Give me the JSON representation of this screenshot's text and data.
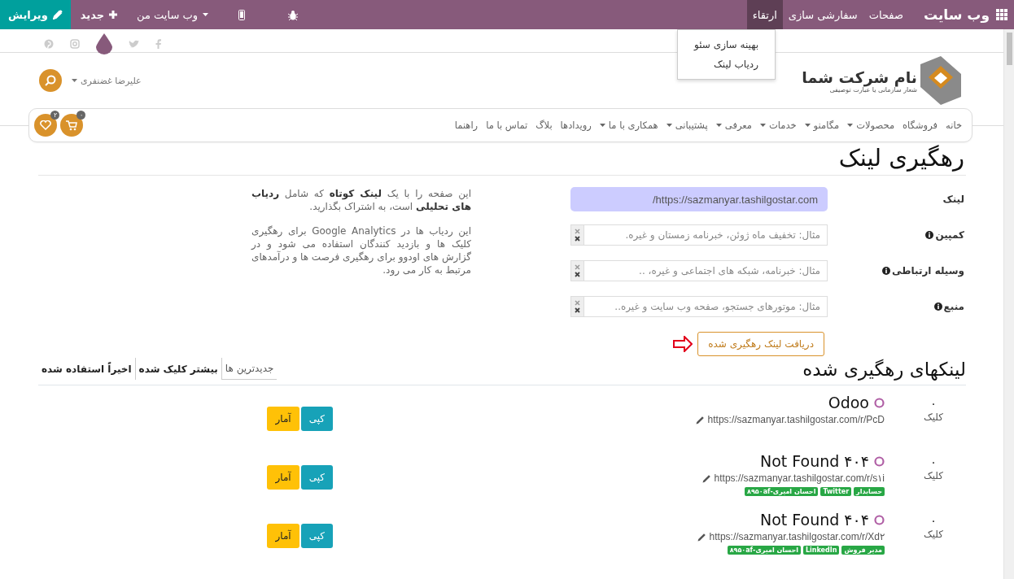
{
  "top_bar": {
    "app_title": "وب سایت",
    "menus": [
      {
        "label": "صفحات",
        "selected": false
      },
      {
        "label": "سفارشی سازی",
        "selected": false
      },
      {
        "label": "ارتقاء",
        "selected": true
      }
    ],
    "actions": [
      {
        "kind": "debug"
      },
      {
        "kind": "mobile"
      },
      {
        "kind": "dropdown",
        "label": "وب سایت من"
      },
      {
        "kind": "new",
        "label": "جدید"
      },
      {
        "kind": "edit",
        "label": "ویرایش"
      }
    ]
  },
  "dropdown_menu": [
    "بهینه سازی سئو",
    "ردیاب لینک"
  ],
  "header": {
    "company_name": "نام شرکت شما",
    "tagline": "شعار سازمانی یا عبارت توصیفی",
    "user_name": "علیرضا غضنفری"
  },
  "nav": {
    "items": [
      {
        "label": "خانه",
        "dropdown": false
      },
      {
        "label": "فروشگاه",
        "dropdown": false
      },
      {
        "label": "محصولات",
        "dropdown": true
      },
      {
        "label": "مگامنو",
        "dropdown": true
      },
      {
        "label": "خدمات",
        "dropdown": true
      },
      {
        "label": "معرفی",
        "dropdown": true
      },
      {
        "label": "پشتیبانی",
        "dropdown": true
      },
      {
        "label": "همکاری با ما",
        "dropdown": true
      },
      {
        "label": "رویدادها",
        "dropdown": false
      },
      {
        "label": "بلاگ",
        "dropdown": false
      },
      {
        "label": "تماس با ما",
        "dropdown": false
      },
      {
        "label": "راهنما",
        "dropdown": false
      }
    ],
    "cart_count": "۰",
    "wishlist_count": "۲"
  },
  "page_title": "رهگیری لینک",
  "form": {
    "fields": [
      {
        "kind": "url",
        "label": "لینک",
        "info": false,
        "value": "https://sazmanyar.tashilgostar.com/"
      },
      {
        "kind": "select",
        "label": "کمپین",
        "info": true,
        "placeholder": "مثال: تخفیف ماه ژوئن، خبرنامه زمستان و غیره."
      },
      {
        "kind": "select",
        "label": "وسیله ارتباطی",
        "info": true,
        "placeholder": "مثال: خبرنامه، شبکه های اجتماعی و غیره، .."
      },
      {
        "kind": "select",
        "label": "منبع",
        "info": true,
        "placeholder": "مثال: موتورهای جستجو، صفحه وب سایت و غیره.."
      }
    ],
    "submit": "دریافت لینک رهگیری شده"
  },
  "help": [
    "این صفحه را با یک **لینک کوتاه** که شامل **ردیاب های تحلیلی** است، به اشتراک بگذارید.",
    "این ردیاب ها در Google Analytics برای رهگیری کلیک ها و بازدید کنندگان استفاده می شود و در گزارش های اودوو برای رهگیری فرصت ها و درآمدهای مرتبط به کار می رود."
  ],
  "links_section": {
    "title": "لینکهای رهگیری شده",
    "tabs": [
      {
        "label": "جدیدترین ها",
        "selected": true
      },
      {
        "label": "بیشتر کلیک شده",
        "selected": false
      },
      {
        "label": "اخیراً استفاده شده",
        "selected": false
      }
    ],
    "rows": [
      {
        "clicks": "۰",
        "clicks_label": "کلیک",
        "title": "Odoo",
        "url": "https://sazmanyar.tashilgostar.com/r/PcD",
        "tags": [],
        "copy": "کپی",
        "stats": "آمار"
      },
      {
        "clicks": "۰",
        "clicks_label": "کلیک",
        "title": "Not Found ۴۰۴",
        "url": "https://sazmanyar.tashilgostar.com/r/s۱i",
        "tags": [
          "حسابدار",
          "Twitter",
          "احسان امیری-۸۹۵۰af"
        ],
        "copy": "کپی",
        "stats": "آمار"
      },
      {
        "clicks": "۰",
        "clicks_label": "کلیک",
        "title": "Not Found ۴۰۴",
        "url": "https://sazmanyar.tashilgostar.com/r/Xd۲",
        "tags": [
          "مدیر فروش",
          "LinkedIn",
          "احسان امیری-۸۹۵۰af"
        ],
        "copy": "کپی",
        "stats": "آمار"
      }
    ]
  }
}
